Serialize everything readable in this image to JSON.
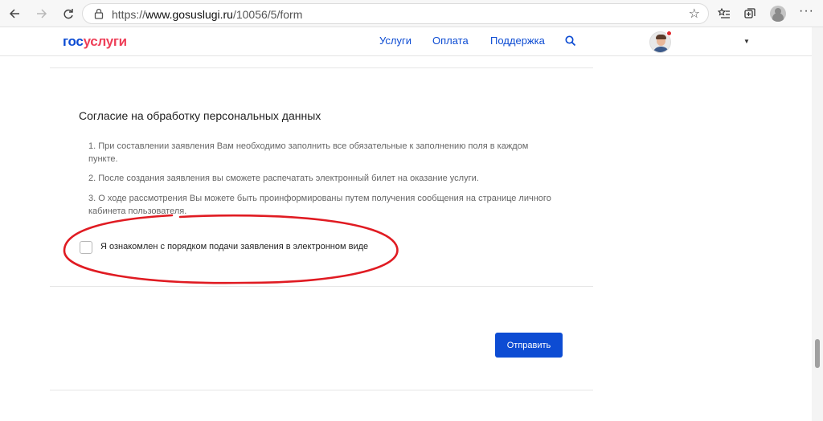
{
  "browser": {
    "url_scheme": "https://",
    "url_host": "www.gosuslugi.ru",
    "url_path": "/10056/5/form"
  },
  "header": {
    "logo_part1": "гос",
    "logo_part2": "услуги",
    "nav": [
      {
        "label": "Услуги"
      },
      {
        "label": "Оплата"
      },
      {
        "label": "Поддержка"
      }
    ]
  },
  "consent": {
    "title": "Согласие на обработку персональных данных",
    "items": [
      "1. При составлении заявления Вам необходимо заполнить все обязательные к заполнению поля в каждом пункте.",
      "2. После создания заявления вы сможете распечатать электронный билет на оказание услуги.",
      "3. О ходе рассмотрения Вы можете быть проинформированы путем получения сообщения на странице личного кабинета пользователя."
    ],
    "checkbox_label": "Я ознакомлен с порядком подачи заявления в электронном виде",
    "checkbox_checked": false
  },
  "actions": {
    "submit_label": "Отправить"
  },
  "colors": {
    "brand_blue": "#0d4cd3",
    "brand_red": "#ee3f58",
    "annotation_red": "#e01b22"
  }
}
